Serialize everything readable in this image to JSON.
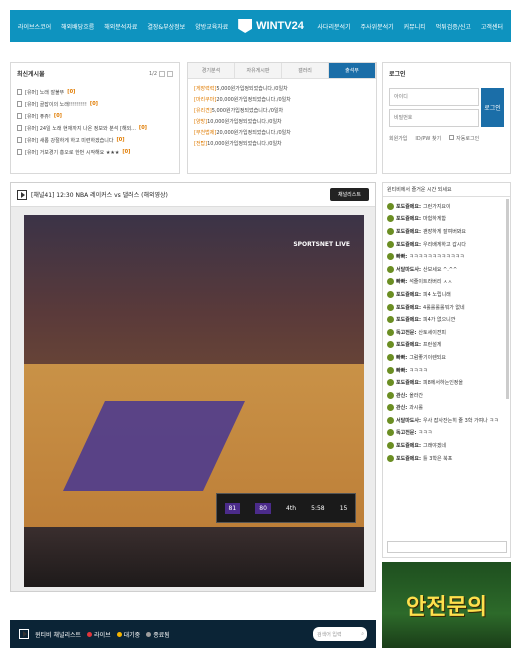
{
  "nav": {
    "left_links": [
      "라이브스코어",
      "해외배당흐름",
      "해외분석자료",
      "결장&부상정보",
      "양방교육자료"
    ],
    "logo": "WINTV24",
    "right_links": [
      "사다리분석기",
      "주사위분석기",
      "커뮤니티",
      "먹튀검증/신고",
      "고객센터"
    ]
  },
  "latest": {
    "title": "최신게시물",
    "page": "1/2",
    "items": [
      {
        "text": "[유머] 노래 잘불뚜",
        "count": "[0]"
      },
      {
        "text": "[유머] 골잡이의 노래!!!!!!!!!",
        "count": "[0]"
      },
      {
        "text": "[유머] 퓨쥬!",
        "count": "[0]"
      },
      {
        "text": "[유머] 24일 노래 현재까지 나온 정보와 분석 [해외...",
        "count": "[0]"
      },
      {
        "text": "[유머] 새롭 강절하게 하고 미련하겠습니다",
        "count": "[0]"
      },
      {
        "text": "[유머] 거보경기 흥오로 한번 시작해요 ★★★",
        "count": "[0]"
      }
    ]
  },
  "notice": {
    "tabs": [
      "경기분석",
      "자유게시판",
      "갤러리",
      "출석부"
    ],
    "active_tab": 3,
    "items": [
      {
        "tag": "[게장력력]",
        "text": "5,000원가입정되었습니다./0일차"
      },
      {
        "tag": "[마리쿠마]",
        "text": "20,000원가입정되었습니다./0일차"
      },
      {
        "tag": "[유리견]",
        "text": "5,000원가입정되었습니다./0일차"
      },
      {
        "tag": "[양방]",
        "text": "10,000원가입정되었습니다./0일차"
      },
      {
        "tag": "[부천법제]",
        "text": "20,000원가입정되었습니다./0일차"
      },
      {
        "tag": "[전탑]",
        "text": "10,000원가입정되었습니다./0일차"
      }
    ]
  },
  "login": {
    "title": "로그인",
    "id_placeholder": "아이디",
    "pw_placeholder": "비밀번호",
    "button": "로그인",
    "signup": "회원가입",
    "find": "ID/PW 찾기",
    "auto": "자동로그인"
  },
  "video": {
    "title": "[채널41] 12:30 NBA 레이커스 vs 댈러스 (해외영상)",
    "channel_button": "채널리스트",
    "broadcast": "SPORTSNET LIVE",
    "score_home": "81",
    "score_away": "80",
    "quarter": "4th",
    "clock": "5:58",
    "shot": "15"
  },
  "playlist": {
    "title": "윈티비 채널리스트",
    "live": "라이브",
    "waiting": "대기중",
    "ended": "종료됨",
    "search_placeholder": "검색어 입력",
    "colors": {
      "live": "#e0353b",
      "waiting": "#f5b400",
      "ended": "#9e9e9e"
    }
  },
  "chat": {
    "header": "윈티비에서 즐거운 시간 되세요",
    "messages": [
      {
        "nick": "포도쥴메요:",
        "text": "그런가지요이"
      },
      {
        "nick": "포도쥴메요:",
        "text": "마험하게함"
      },
      {
        "nick": "포도쥴메요:",
        "text": "괜장하게 잘여버봐요"
      },
      {
        "nick": "포도쥴메요:",
        "text": "우리배게하고 갑시다"
      },
      {
        "nick": "빠빠:",
        "text": "ㅋㅋㅋㅋㅋㅋㅋㅋㅋㅋㅋㅋ"
      },
      {
        "nick": "서달마도사:",
        "text": "산보세요 ^.^^"
      },
      {
        "nick": "빠빠:",
        "text": "석줄이트라버리 ㅅㅅ"
      },
      {
        "nick": "포도쥴메요:",
        "text": "피4 노립니래"
      },
      {
        "nick": "포도쥴메요:",
        "text": "4롤롤롤롤뭐가 없네"
      },
      {
        "nick": "포도쥴메요:",
        "text": "피4가 없으니깐"
      },
      {
        "nick": "독고전문:",
        "text": "산토세이젼피"
      },
      {
        "nick": "포도쥴메요:",
        "text": "프런설게"
      },
      {
        "nick": "빠빠:",
        "text": "그럼좋기이렌되요"
      },
      {
        "nick": "빠빠:",
        "text": "ㅋㅋㅋㅋ"
      },
      {
        "nick": "포도쥴메요:",
        "text": "피8에서하는인정을"
      },
      {
        "nick": "관신:",
        "text": "올라간"
      },
      {
        "nick": "관신:",
        "text": "과시롤"
      },
      {
        "nick": "서달마도사:",
        "text": "우사 잡사잔는히 줄 3학 가여나 ㅋㅋ"
      },
      {
        "nick": "독고전문:",
        "text": "ㅋㅋㅋ"
      },
      {
        "nick": "포도쥴메요:",
        "text": "그래야겠네"
      },
      {
        "nick": "포도쥴메요:",
        "text": "틀 3학은 북포"
      }
    ]
  },
  "banner": {
    "text": "안전문의",
    "text_color": "#ffe04d"
  },
  "colors": {
    "nav": "#0e93bf",
    "accent": "#1b6ea8",
    "count": "#e07b00"
  }
}
